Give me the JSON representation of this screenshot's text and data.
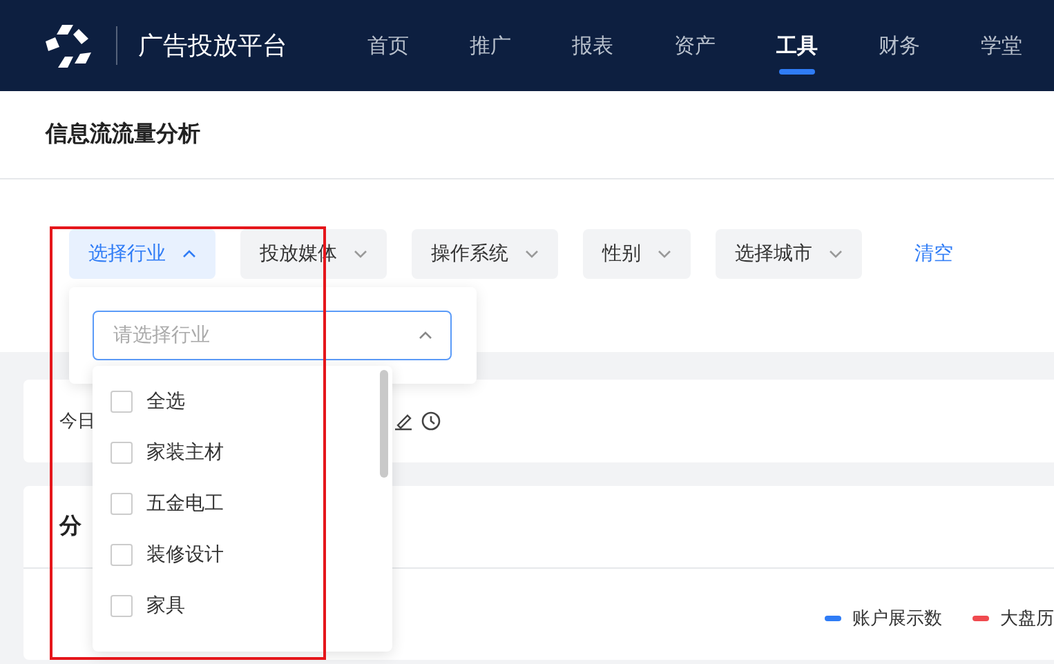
{
  "header": {
    "brand": "广告投放平台",
    "nav": [
      {
        "label": "首页",
        "selected": false
      },
      {
        "label": "推广",
        "selected": false
      },
      {
        "label": "报表",
        "selected": false
      },
      {
        "label": "资产",
        "selected": false
      },
      {
        "label": "工具",
        "selected": true
      },
      {
        "label": "财务",
        "selected": false
      },
      {
        "label": "学堂",
        "selected": false
      }
    ]
  },
  "page_title": "信息流流量分析",
  "filters": [
    {
      "label": "选择行业",
      "expanded": true
    },
    {
      "label": "投放媒体",
      "expanded": false
    },
    {
      "label": "操作系统",
      "expanded": false
    },
    {
      "label": "性别",
      "expanded": false
    },
    {
      "label": "选择城市",
      "expanded": false
    }
  ],
  "clear_link": "清空",
  "industry_dropdown": {
    "placeholder": "请选择行业",
    "options": [
      {
        "label": "全选",
        "checked": false
      },
      {
        "label": "家装主材",
        "checked": false
      },
      {
        "label": "五金电工",
        "checked": false
      },
      {
        "label": "装修设计",
        "checked": false
      },
      {
        "label": "家具",
        "checked": false
      }
    ]
  },
  "summary_card": {
    "label": "今日"
  },
  "chart_card": {
    "title": "分",
    "legend": [
      {
        "label": "账户展示数",
        "color": "#2f7cf6"
      },
      {
        "label": "大盘历",
        "color": "#f04a4f"
      }
    ]
  }
}
